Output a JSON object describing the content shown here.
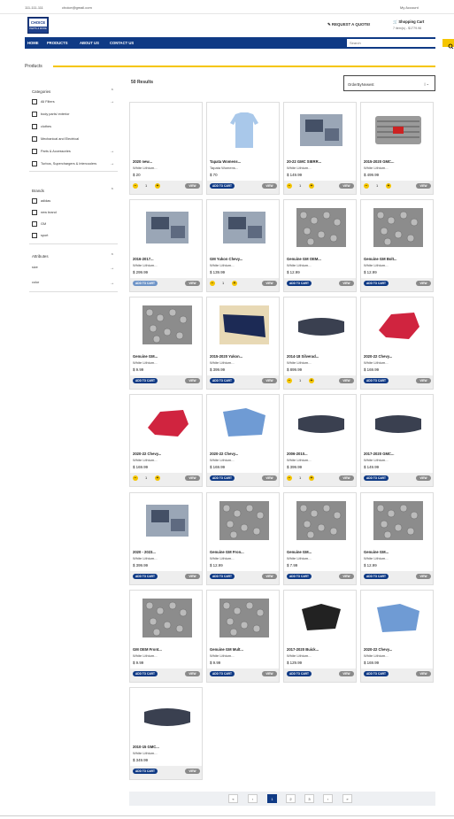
{
  "topbar": {
    "phone": "111-111-111",
    "email": "choice@gmail.com",
    "account": "My Account"
  },
  "logo": {
    "line1": "CHOICE",
    "line2": "PARTS & MORE"
  },
  "header": {
    "quote": "REQUEST A QUOTE!",
    "cart_label": "Shopping Cart",
    "cart_sub": "7 item(s) - $1779.96"
  },
  "nav": {
    "items": [
      "HOME",
      "PRODUCTS",
      "ABOUT US",
      "CONTACT US"
    ],
    "search_placeholder": "Search"
  },
  "page_title": "Products",
  "sidebar": {
    "categories_title": "Categories",
    "categories": [
      "All Filters",
      "body parts/ exterior",
      "clothes",
      "Mechanical and Electrical",
      "Parts & Accessories",
      "Turbos, Superchargers & Intercoolers"
    ],
    "brands_title": "Brands",
    "brands": [
      "adidas",
      "new brand",
      "GM",
      "sport"
    ],
    "attributes_title": "Attributes",
    "attributes": [
      "size",
      "color"
    ]
  },
  "results": "50 Results",
  "sort": "OrderByNewest",
  "buttons": {
    "add": "ADD TO CART",
    "view": "VIEW",
    "qty": "1"
  },
  "products": [
    {
      "title": "2020 new...",
      "sub": "White Lithium...",
      "price": "$ 20"
    },
    {
      "title": "Tapata Womens...",
      "sub": "Tapata Womens...",
      "price": "$ 70"
    },
    {
      "title": "20-22 GMC SIERR...",
      "sub": "White Lithium...",
      "price": "$ 149.99"
    },
    {
      "title": "2015-2020 GMC...",
      "sub": "White Lithium...",
      "price": "$ 499.99"
    },
    {
      "title": "2016-2017...",
      "sub": "White Lithium...",
      "price": "$ 299.99"
    },
    {
      "title": "GM Yukon Chevy...",
      "sub": "White Lithium...",
      "price": "$ 139.99"
    },
    {
      "title": "Genuine GM OEM...",
      "sub": "White Lithium...",
      "price": "$ 12.99"
    },
    {
      "title": "Genuine GM Bolt...",
      "sub": "White Lithium...",
      "price": "$ 12.99"
    },
    {
      "title": "Genuine GM...",
      "sub": "White Lithium...",
      "price": "$ 9.99"
    },
    {
      "title": "2015-2020 Yukon...",
      "sub": "White Lithium...",
      "price": "$ 399.99"
    },
    {
      "title": "2014-18 Silverad...",
      "sub": "White Lithium...",
      "price": "$ 899.99"
    },
    {
      "title": "2020-22 Chevy...",
      "sub": "White Lithium...",
      "price": "$ 169.99"
    },
    {
      "title": "2020-22 Chevy...",
      "sub": "White Lithium...",
      "price": "$ 169.99"
    },
    {
      "title": "2020-22 Chevy...",
      "sub": "White Lithium...",
      "price": "$ 169.99"
    },
    {
      "title": "2006-2010...",
      "sub": "White Lithium...",
      "price": "$ 399.99"
    },
    {
      "title": "2017-2020 GMC...",
      "sub": "White Lithium...",
      "price": "$ 149.99"
    },
    {
      "title": "2020 - 2023...",
      "sub": "White Lithium...",
      "price": "$ 399.99"
    },
    {
      "title": "Genuine GM Fron...",
      "sub": "White Lithium...",
      "price": "$ 12.99"
    },
    {
      "title": "Genuine GM...",
      "sub": "White Lithium...",
      "price": "$ 7.99"
    },
    {
      "title": "Genuine GM...",
      "sub": "White Lithium...",
      "price": "$ 12.99"
    },
    {
      "title": "GM OEM Front...",
      "sub": "White Lithium...",
      "price": "$ 9.99"
    },
    {
      "title": "Genuine GM Mult...",
      "sub": "White Lithium...",
      "price": "$ 9.99"
    },
    {
      "title": "2017-2020 Buick...",
      "sub": "White Lithium...",
      "price": "$ 129.99"
    },
    {
      "title": "2020-22 Chevy...",
      "sub": "White Lithium...",
      "price": "$ 169.99"
    },
    {
      "title": "2010-15 GMC...",
      "sub": "White Lithium...",
      "price": "$ 349.99"
    }
  ],
  "pager": [
    "«",
    "‹",
    "1",
    "2",
    "3",
    "›",
    "»"
  ]
}
